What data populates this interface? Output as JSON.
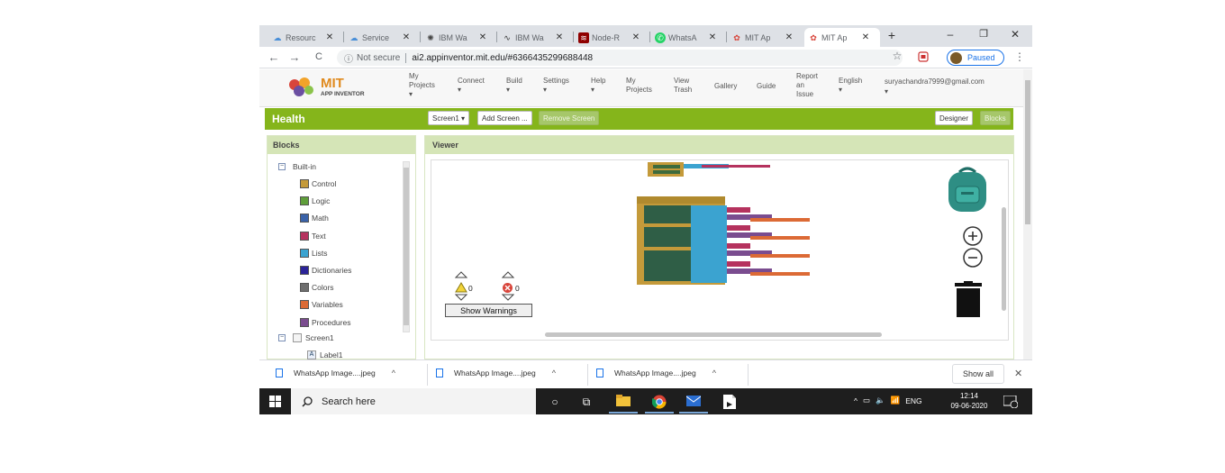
{
  "browser": {
    "tabs": [
      {
        "label": "Resourc",
        "icon": "cloud-icon"
      },
      {
        "label": "Service",
        "icon": "cloud-icon"
      },
      {
        "label": "IBM Wa",
        "icon": "ibm-bulb-icon"
      },
      {
        "label": "IBM Wa",
        "icon": "ibm-waveform-icon"
      },
      {
        "label": "Node-R",
        "icon": "node-red-icon"
      },
      {
        "label": "WhatsA",
        "icon": "whatsapp-icon"
      },
      {
        "label": "MIT Ap",
        "icon": "mit-app-inventor-icon"
      },
      {
        "label": "MIT Ap",
        "icon": "mit-app-inventor-icon"
      }
    ],
    "new_tab": "+",
    "minimize": "–",
    "restore": "❐",
    "close": "✕",
    "back": "←",
    "forward": "→",
    "reload": "C",
    "not_secure": "Not secure",
    "url": "ai2.appinventor.mit.edu/#6366435299688448",
    "star": "☆",
    "paused": "Paused",
    "menu": "⋮"
  },
  "app": {
    "logo_title": "MIT",
    "logo_sub": "APP INVENTOR",
    "menu": [
      {
        "lines": [
          "My",
          "Projects",
          "▾"
        ]
      },
      {
        "lines": [
          "Connect",
          "▾"
        ]
      },
      {
        "lines": [
          "Build",
          "▾"
        ]
      },
      {
        "lines": [
          "Settings",
          "▾"
        ]
      },
      {
        "lines": [
          "Help",
          "▾"
        ]
      },
      {
        "lines": [
          "My",
          "Projects"
        ]
      },
      {
        "lines": [
          "View",
          "Trash"
        ]
      },
      {
        "lines": [
          "Gallery"
        ]
      },
      {
        "lines": [
          "Guide"
        ]
      },
      {
        "lines": [
          "Report",
          "an",
          "Issue"
        ]
      },
      {
        "lines": [
          "English",
          "▾"
        ]
      }
    ],
    "email": "suryachandra7999@gmail.com",
    "email_caret": "▾",
    "project_name": "Health",
    "screen_select": "Screen1 ▾",
    "add_screen": "Add Screen ...",
    "remove_screen": "Remove Screen",
    "designer": "Designer",
    "blocks": "Blocks"
  },
  "blocks_panel": {
    "title": "Blocks",
    "builtin": "Built-in",
    "items": [
      {
        "label": "Control",
        "color": "#c49a3a"
      },
      {
        "label": "Logic",
        "color": "#5f9e3a"
      },
      {
        "label": "Math",
        "color": "#3a62a8"
      },
      {
        "label": "Text",
        "color": "#b5325e"
      },
      {
        "label": "Lists",
        "color": "#3ba3d0"
      },
      {
        "label": "Dictionaries",
        "color": "#2b2398"
      },
      {
        "label": "Colors",
        "color": "#6e6e6e"
      },
      {
        "label": "Variables",
        "color": "#dc6a35"
      },
      {
        "label": "Procedures",
        "color": "#7a4c8f"
      }
    ],
    "screen": "Screen1",
    "label1": "Label1"
  },
  "viewer": {
    "title": "Viewer",
    "warnings_count": "0",
    "errors_count": "0",
    "show_warnings": "Show Warnings",
    "zoom_in": "+",
    "zoom_out": "−"
  },
  "downloads": {
    "files": [
      "WhatsApp Image....jpeg",
      "WhatsApp Image....jpeg",
      "WhatsApp Image....jpeg"
    ],
    "show_all": "Show all",
    "close": "✕"
  },
  "taskbar": {
    "search_placeholder": "Search here",
    "lang": "ENG",
    "time": "12:14",
    "date": "09-06-2020"
  }
}
